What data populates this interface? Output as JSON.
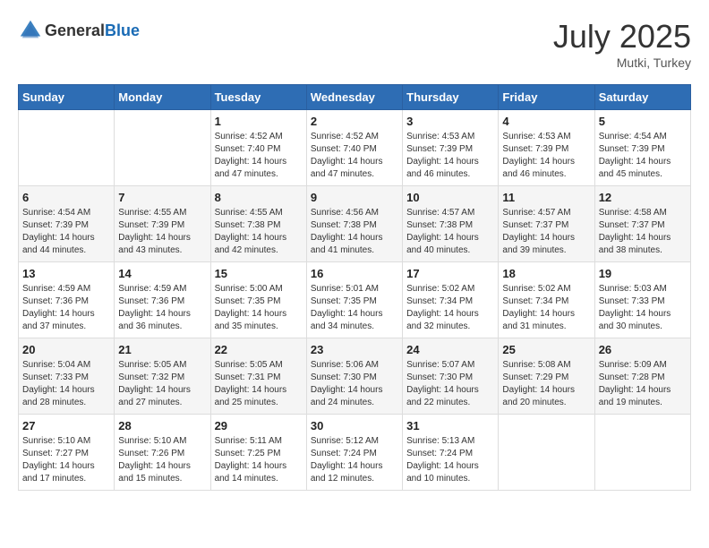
{
  "header": {
    "logo_general": "General",
    "logo_blue": "Blue",
    "month": "July 2025",
    "location": "Mutki, Turkey"
  },
  "weekdays": [
    "Sunday",
    "Monday",
    "Tuesday",
    "Wednesday",
    "Thursday",
    "Friday",
    "Saturday"
  ],
  "weeks": [
    [
      {
        "day": "",
        "sunrise": "",
        "sunset": "",
        "daylight": ""
      },
      {
        "day": "",
        "sunrise": "",
        "sunset": "",
        "daylight": ""
      },
      {
        "day": "1",
        "sunrise": "Sunrise: 4:52 AM",
        "sunset": "Sunset: 7:40 PM",
        "daylight": "Daylight: 14 hours and 47 minutes."
      },
      {
        "day": "2",
        "sunrise": "Sunrise: 4:52 AM",
        "sunset": "Sunset: 7:40 PM",
        "daylight": "Daylight: 14 hours and 47 minutes."
      },
      {
        "day": "3",
        "sunrise": "Sunrise: 4:53 AM",
        "sunset": "Sunset: 7:39 PM",
        "daylight": "Daylight: 14 hours and 46 minutes."
      },
      {
        "day": "4",
        "sunrise": "Sunrise: 4:53 AM",
        "sunset": "Sunset: 7:39 PM",
        "daylight": "Daylight: 14 hours and 46 minutes."
      },
      {
        "day": "5",
        "sunrise": "Sunrise: 4:54 AM",
        "sunset": "Sunset: 7:39 PM",
        "daylight": "Daylight: 14 hours and 45 minutes."
      }
    ],
    [
      {
        "day": "6",
        "sunrise": "Sunrise: 4:54 AM",
        "sunset": "Sunset: 7:39 PM",
        "daylight": "Daylight: 14 hours and 44 minutes."
      },
      {
        "day": "7",
        "sunrise": "Sunrise: 4:55 AM",
        "sunset": "Sunset: 7:39 PM",
        "daylight": "Daylight: 14 hours and 43 minutes."
      },
      {
        "day": "8",
        "sunrise": "Sunrise: 4:55 AM",
        "sunset": "Sunset: 7:38 PM",
        "daylight": "Daylight: 14 hours and 42 minutes."
      },
      {
        "day": "9",
        "sunrise": "Sunrise: 4:56 AM",
        "sunset": "Sunset: 7:38 PM",
        "daylight": "Daylight: 14 hours and 41 minutes."
      },
      {
        "day": "10",
        "sunrise": "Sunrise: 4:57 AM",
        "sunset": "Sunset: 7:38 PM",
        "daylight": "Daylight: 14 hours and 40 minutes."
      },
      {
        "day": "11",
        "sunrise": "Sunrise: 4:57 AM",
        "sunset": "Sunset: 7:37 PM",
        "daylight": "Daylight: 14 hours and 39 minutes."
      },
      {
        "day": "12",
        "sunrise": "Sunrise: 4:58 AM",
        "sunset": "Sunset: 7:37 PM",
        "daylight": "Daylight: 14 hours and 38 minutes."
      }
    ],
    [
      {
        "day": "13",
        "sunrise": "Sunrise: 4:59 AM",
        "sunset": "Sunset: 7:36 PM",
        "daylight": "Daylight: 14 hours and 37 minutes."
      },
      {
        "day": "14",
        "sunrise": "Sunrise: 4:59 AM",
        "sunset": "Sunset: 7:36 PM",
        "daylight": "Daylight: 14 hours and 36 minutes."
      },
      {
        "day": "15",
        "sunrise": "Sunrise: 5:00 AM",
        "sunset": "Sunset: 7:35 PM",
        "daylight": "Daylight: 14 hours and 35 minutes."
      },
      {
        "day": "16",
        "sunrise": "Sunrise: 5:01 AM",
        "sunset": "Sunset: 7:35 PM",
        "daylight": "Daylight: 14 hours and 34 minutes."
      },
      {
        "day": "17",
        "sunrise": "Sunrise: 5:02 AM",
        "sunset": "Sunset: 7:34 PM",
        "daylight": "Daylight: 14 hours and 32 minutes."
      },
      {
        "day": "18",
        "sunrise": "Sunrise: 5:02 AM",
        "sunset": "Sunset: 7:34 PM",
        "daylight": "Daylight: 14 hours and 31 minutes."
      },
      {
        "day": "19",
        "sunrise": "Sunrise: 5:03 AM",
        "sunset": "Sunset: 7:33 PM",
        "daylight": "Daylight: 14 hours and 30 minutes."
      }
    ],
    [
      {
        "day": "20",
        "sunrise": "Sunrise: 5:04 AM",
        "sunset": "Sunset: 7:33 PM",
        "daylight": "Daylight: 14 hours and 28 minutes."
      },
      {
        "day": "21",
        "sunrise": "Sunrise: 5:05 AM",
        "sunset": "Sunset: 7:32 PM",
        "daylight": "Daylight: 14 hours and 27 minutes."
      },
      {
        "day": "22",
        "sunrise": "Sunrise: 5:05 AM",
        "sunset": "Sunset: 7:31 PM",
        "daylight": "Daylight: 14 hours and 25 minutes."
      },
      {
        "day": "23",
        "sunrise": "Sunrise: 5:06 AM",
        "sunset": "Sunset: 7:30 PM",
        "daylight": "Daylight: 14 hours and 24 minutes."
      },
      {
        "day": "24",
        "sunrise": "Sunrise: 5:07 AM",
        "sunset": "Sunset: 7:30 PM",
        "daylight": "Daylight: 14 hours and 22 minutes."
      },
      {
        "day": "25",
        "sunrise": "Sunrise: 5:08 AM",
        "sunset": "Sunset: 7:29 PM",
        "daylight": "Daylight: 14 hours and 20 minutes."
      },
      {
        "day": "26",
        "sunrise": "Sunrise: 5:09 AM",
        "sunset": "Sunset: 7:28 PM",
        "daylight": "Daylight: 14 hours and 19 minutes."
      }
    ],
    [
      {
        "day": "27",
        "sunrise": "Sunrise: 5:10 AM",
        "sunset": "Sunset: 7:27 PM",
        "daylight": "Daylight: 14 hours and 17 minutes."
      },
      {
        "day": "28",
        "sunrise": "Sunrise: 5:10 AM",
        "sunset": "Sunset: 7:26 PM",
        "daylight": "Daylight: 14 hours and 15 minutes."
      },
      {
        "day": "29",
        "sunrise": "Sunrise: 5:11 AM",
        "sunset": "Sunset: 7:25 PM",
        "daylight": "Daylight: 14 hours and 14 minutes."
      },
      {
        "day": "30",
        "sunrise": "Sunrise: 5:12 AM",
        "sunset": "Sunset: 7:24 PM",
        "daylight": "Daylight: 14 hours and 12 minutes."
      },
      {
        "day": "31",
        "sunrise": "Sunrise: 5:13 AM",
        "sunset": "Sunset: 7:24 PM",
        "daylight": "Daylight: 14 hours and 10 minutes."
      },
      {
        "day": "",
        "sunrise": "",
        "sunset": "",
        "daylight": ""
      },
      {
        "day": "",
        "sunrise": "",
        "sunset": "",
        "daylight": ""
      }
    ]
  ]
}
